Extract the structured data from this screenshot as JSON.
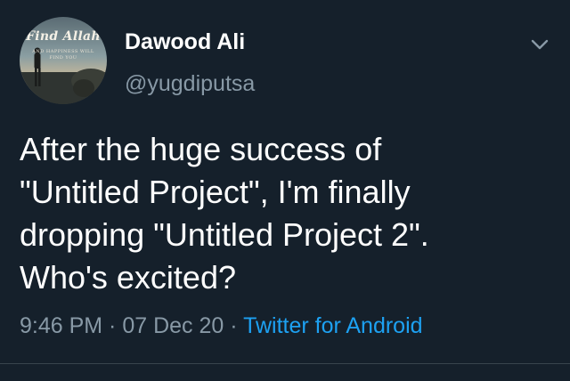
{
  "colors": {
    "background": "#15202b",
    "primary_text": "#ffffff",
    "secondary_text": "#8899a6",
    "link": "#1da1f2",
    "divider": "#38444d"
  },
  "author": {
    "display_name": "Dawood Ali",
    "username": "@yugdiputsa",
    "avatar": {
      "icon": "profile-avatar",
      "script_text": "Find Allah",
      "tagline_line1": "AND HAPPINESS WILL",
      "tagline_line2": "FIND YOU"
    }
  },
  "header": {
    "menu_icon": "chevron-down-icon"
  },
  "tweet": {
    "text_lines": [
      "After the huge success of",
      "\"Untitled Project\", I'm finally",
      "dropping \"Untitled Project 2\".",
      "Who's excited?"
    ]
  },
  "meta": {
    "time": "9:46 PM",
    "separator": " · ",
    "date": "07 Dec 20",
    "source": "Twitter for Android"
  }
}
